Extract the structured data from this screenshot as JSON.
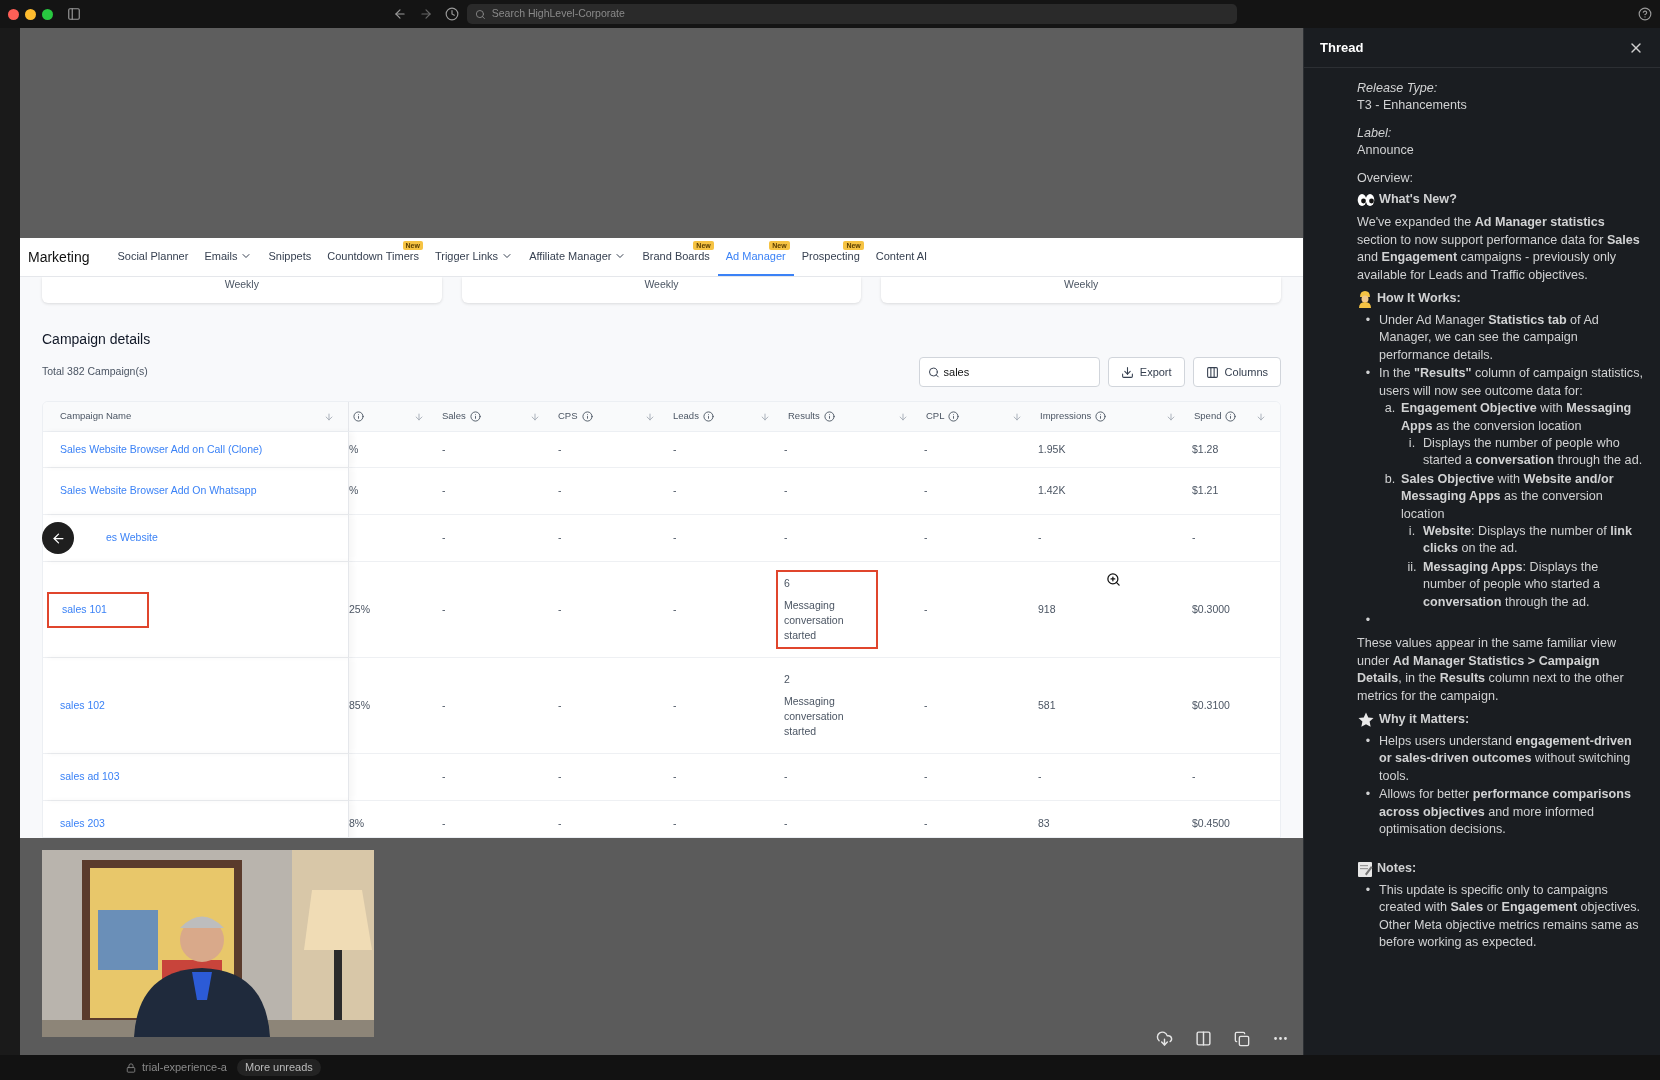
{
  "top_bar": {
    "search_placeholder": "Search HighLevel-Corporate"
  },
  "app": {
    "section_title": "Marketing",
    "nav": [
      {
        "label": "Social Planner",
        "selected": false,
        "dropdown": false
      },
      {
        "label": "Emails",
        "selected": false,
        "dropdown": true
      },
      {
        "label": "Snippets",
        "selected": false,
        "dropdown": false
      },
      {
        "label": "Countdown Timers",
        "selected": false,
        "dropdown": false,
        "badge": "New"
      },
      {
        "label": "Trigger Links",
        "selected": false,
        "dropdown": true
      },
      {
        "label": "Affiliate Manager",
        "selected": false,
        "dropdown": true
      },
      {
        "label": "Brand Boards",
        "selected": false,
        "dropdown": false,
        "badge": "New"
      },
      {
        "label": "Ad Manager",
        "selected": true,
        "dropdown": false,
        "badge": "New"
      },
      {
        "label": "Prospecting",
        "selected": false,
        "dropdown": false,
        "badge": "New"
      },
      {
        "label": "Content AI",
        "selected": false,
        "dropdown": false
      }
    ],
    "summary_cards": [
      {
        "label": "Weekly"
      },
      {
        "label": "Weekly"
      },
      {
        "label": "Weekly"
      }
    ],
    "campaigns": {
      "title": "Campaign details",
      "total": "Total 382 Campaign(s)",
      "search": {
        "value": "sales"
      },
      "buttons": [
        "Export",
        "Columns"
      ],
      "columns": [
        {
          "label": "Campaign Name",
          "info": false
        },
        {
          "info": true
        },
        {
          "label": "Sales",
          "info": true
        },
        {
          "label": "CPS",
          "info": true
        },
        {
          "label": "Leads",
          "info": true
        },
        {
          "label": "Results",
          "info": true
        },
        {
          "label": "CPL",
          "info": true
        },
        {
          "label": "Impressions",
          "info": true
        },
        {
          "label": "Spend",
          "info": true
        }
      ],
      "rows": [
        {
          "cells": [
            {
              "text": "Sales Website Browser Add on Call (Clone)",
              "highlighted": false
            },
            {
              "text": "%"
            },
            {
              "text": "-"
            },
            {
              "text": "-"
            },
            {
              "text": "-"
            },
            {
              "text": "-",
              "highlighted": false
            },
            {
              "text": "-"
            },
            {
              "text": "1.95K"
            },
            {
              "text": "$1.28"
            }
          ]
        },
        {
          "cells": [
            {
              "text": "Sales Website Browser Add On Whatsapp",
              "highlighted": false
            },
            {
              "text": "%"
            },
            {
              "text": "-"
            },
            {
              "text": "-"
            },
            {
              "text": "-"
            },
            {
              "text": "-",
              "highlighted": false
            },
            {
              "text": "-"
            },
            {
              "text": "1.42K"
            },
            {
              "text": "$1.21"
            }
          ]
        },
        {
          "cells": [
            {
              "text": "es Website",
              "highlighted": false
            },
            {
              "text": ""
            },
            {
              "text": "-"
            },
            {
              "text": "-"
            },
            {
              "text": "-"
            },
            {
              "text": "-",
              "highlighted": false
            },
            {
              "text": "-"
            },
            {
              "text": "-"
            },
            {
              "text": "-"
            }
          ]
        },
        {
          "cells": [
            {
              "text": "sales 101",
              "highlighted": true
            },
            {
              "text": "25%"
            },
            {
              "text": "-"
            },
            {
              "text": "-"
            },
            {
              "text": "-"
            },
            {
              "text": "6",
              "label": "Messaging conversation started",
              "highlighted": true
            },
            {
              "text": "-"
            },
            {
              "text": "918"
            },
            {
              "text": "$0.3000"
            }
          ]
        },
        {
          "cells": [
            {
              "text": "sales 102",
              "highlighted": false
            },
            {
              "text": "85%"
            },
            {
              "text": "-"
            },
            {
              "text": "-"
            },
            {
              "text": "-"
            },
            {
              "text": "2",
              "label": "Messaging conversation started",
              "highlighted": false
            },
            {
              "text": "-"
            },
            {
              "text": "581"
            },
            {
              "text": "$0.3100"
            }
          ]
        },
        {
          "cells": [
            {
              "text": "sales ad 103",
              "highlighted": false
            },
            {
              "text": ""
            },
            {
              "text": "-"
            },
            {
              "text": "-"
            },
            {
              "text": "-"
            },
            {
              "text": "-",
              "highlighted": false
            },
            {
              "text": "-"
            },
            {
              "text": "-"
            },
            {
              "text": "-"
            }
          ]
        },
        {
          "cells": [
            {
              "text": "sales 203",
              "highlighted": false
            },
            {
              "text": "8%"
            },
            {
              "text": "-"
            },
            {
              "text": "-"
            },
            {
              "text": "-"
            },
            {
              "text": "-",
              "highlighted": false
            },
            {
              "text": "-"
            },
            {
              "text": "83"
            },
            {
              "text": "$0.4500"
            }
          ]
        }
      ]
    }
  },
  "thread": {
    "title": "Thread",
    "blocks": [
      {
        "kind": "label",
        "text": "Release Type:",
        "italic": true
      },
      {
        "kind": "value",
        "text": "T3 - Enhancements"
      },
      {
        "kind": "label",
        "text": "Label:",
        "italic": true
      },
      {
        "kind": "value",
        "text": "Announce"
      },
      {
        "kind": "label",
        "text": "Overview:",
        "italic": false
      },
      {
        "kind": "heading",
        "text": "What's New?"
      },
      {
        "kind": "paragraph",
        "text": "We've expanded the **Ad Manager statistics** section to now support performance data for **Sales** and **Engagement** campaigns - previously only available for Leads and Traffic objectives."
      },
      {
        "kind": "heading",
        "text": "How It Works:"
      },
      {
        "kind": "list",
        "items": [
          {
            "marker": "•",
            "text": "Under Ad Manager **Statistics tab** of Ad Manager, we can see the campaign performance details."
          },
          {
            "marker": "•",
            "text": "In the **\"Results\"** column of campaign statistics, users will now see outcome data for:",
            "children": [
              {
                "marker": "a.",
                "text": "**Engagement Objective** with **Messaging Apps** as the conversion location",
                "children": [
                  {
                    "marker": "i.",
                    "text": "Displays the number of people who started a **conversation** through the ad."
                  }
                ]
              },
              {
                "marker": "b.",
                "text": "**Sales Objective** with **Website and/or Messaging Apps** as the conversion location",
                "children": [
                  {
                    "marker": "i.",
                    "text": "**Website**: Displays the number of **link clicks** on the ad."
                  },
                  {
                    "marker": "ii.",
                    "text": "**Messaging Apps**: Displays the number of people who started a **conversation** through the ad."
                  }
                ]
              }
            ]
          },
          {
            "marker": "•"
          }
        ]
      },
      {
        "kind": "paragraph",
        "text": "These values appear in the same familiar view under **Ad Manager Statistics > Campaign Details**, in the **Results** column next to the other metrics for the campaign."
      },
      {
        "kind": "heading",
        "text": "Why it Matters:"
      },
      {
        "kind": "list",
        "items": [
          {
            "marker": "•",
            "text": "Helps users understand **engagement-driven or sales-driven outcomes** without switching tools."
          },
          {
            "marker": "•",
            "text": "Allows for better **performance comparisons across objectives** and more informed optimisation decisions."
          }
        ]
      },
      {
        "kind": "heading",
        "text": "Notes:"
      },
      {
        "kind": "list",
        "items": [
          {
            "marker": "•",
            "text": "This update is specific only to campaigns created with **Sales** or **Engagement** objectives. Other Meta objective metrics remains same as before working as expected."
          }
        ]
      }
    ]
  },
  "bottom_strip": {
    "channel": "trial-experience-a",
    "unreads": "More unreads"
  }
}
